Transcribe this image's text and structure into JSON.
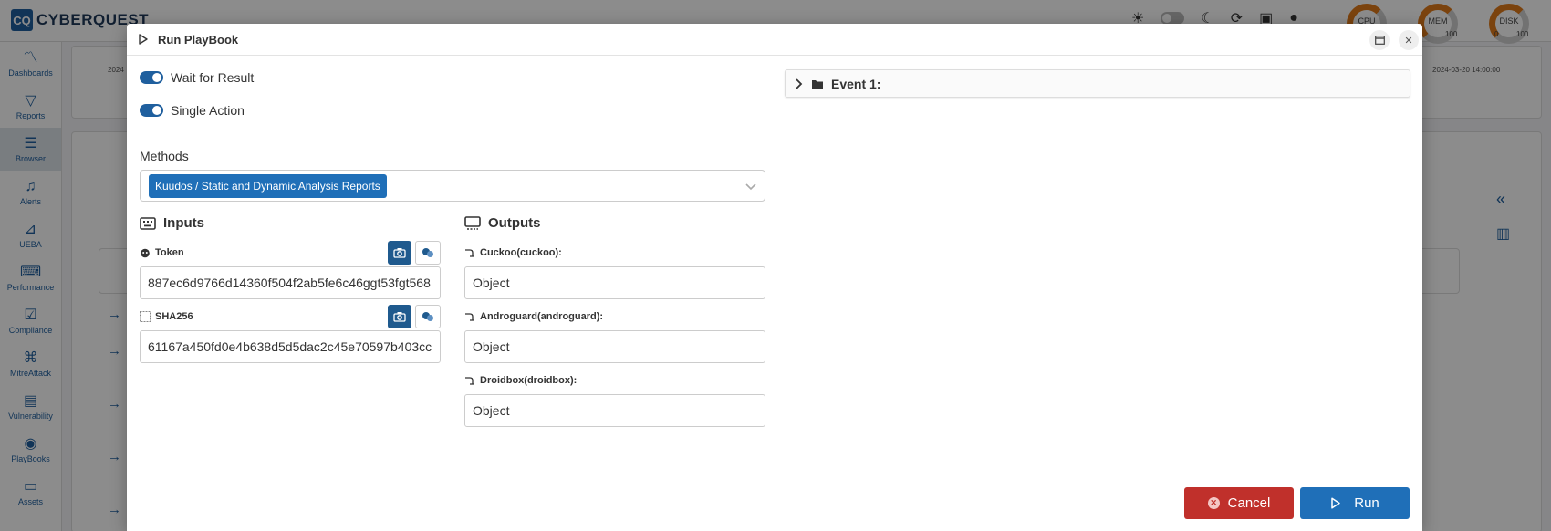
{
  "app": {
    "logo_mark": "CQ",
    "logo_text": "CYBERQUEST",
    "gauges": [
      {
        "label": "CPU",
        "max": ""
      },
      {
        "label": "MEM",
        "max": "100"
      },
      {
        "label": "DISK",
        "min": "0",
        "max": "100"
      }
    ],
    "bg_dates": [
      "2024",
      "2024-03-20 14:00:00"
    ]
  },
  "sidebar": {
    "items": [
      {
        "label": "Dashboards",
        "icon": "chart-line-icon"
      },
      {
        "label": "Reports",
        "icon": "filter-icon"
      },
      {
        "label": "Browser",
        "icon": "list-icon"
      },
      {
        "label": "Alerts",
        "icon": "bell-icon"
      },
      {
        "label": "UEBA",
        "icon": "chart-icon"
      },
      {
        "label": "Performance",
        "icon": "keyboard-icon"
      },
      {
        "label": "Compliance",
        "icon": "compliance-icon"
      },
      {
        "label": "MitreAttack",
        "icon": "command-icon"
      },
      {
        "label": "Vulnerability",
        "icon": "toggles-icon"
      },
      {
        "label": "PlayBooks",
        "icon": "playbook-icon"
      },
      {
        "label": "Assets",
        "icon": "laptop-icon"
      }
    ]
  },
  "modal": {
    "title": "Run PlayBook",
    "wait_for_result": {
      "label": "Wait for Result",
      "on": true
    },
    "single_action": {
      "label": "Single Action",
      "on": true
    },
    "methods": {
      "label": "Methods",
      "selected": "Kuudos / Static and Dynamic Analysis Reports"
    },
    "inputs": {
      "heading": "Inputs",
      "fields": [
        {
          "label": "Token",
          "value": "887ec6d9766d14360f504f2ab5fe6c46ggt53fgt568"
        },
        {
          "label": "SHA256",
          "value": "61167a450fd0e4b638d5d5dac2c45e70597b403cc"
        }
      ]
    },
    "outputs": {
      "heading": "Outputs",
      "fields": [
        {
          "label": "Cuckoo(cuckoo):",
          "value": "Object"
        },
        {
          "label": "Androguard(androguard):",
          "value": "Object"
        },
        {
          "label": "Droidbox(droidbox):",
          "value": "Object"
        }
      ]
    },
    "event": {
      "label": "Event 1:"
    },
    "buttons": {
      "cancel": "Cancel",
      "run": "Run"
    }
  },
  "colors": {
    "primary": "#1f6fb8",
    "danger": "#c0302b",
    "dark_button": "#1f5a8e"
  }
}
